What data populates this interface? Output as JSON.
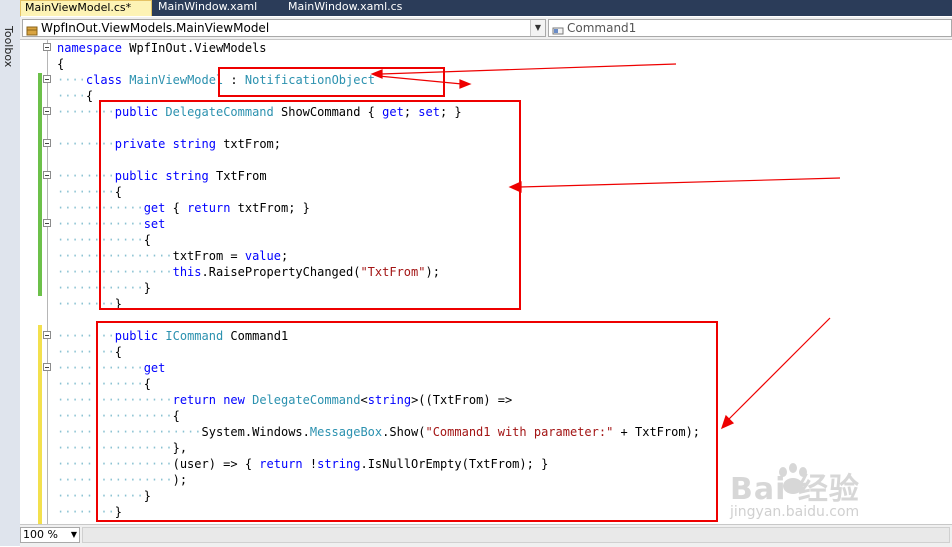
{
  "toolbox": {
    "label": "Toolbox"
  },
  "tabs": [
    {
      "label": "MainViewModel.cs*",
      "active": true
    },
    {
      "label": "MainWindow.xaml",
      "active": false
    },
    {
      "label": "MainWindow.xaml.cs",
      "active": false
    }
  ],
  "navbar": {
    "type_combo": "WpfInOut.ViewModels.MainViewModel",
    "member_combo": "Command1",
    "type_icon": "class-icon",
    "member_icon": "property-icon"
  },
  "code": {
    "l1": {
      "k": "namespace",
      "t": " WpfInOut.ViewModels"
    },
    "l2": {
      "t": "{"
    },
    "l3": {
      "k": "class",
      "a": " ",
      "b": "MainViewModel",
      "c": " : ",
      "d": "NotificationObject"
    },
    "l4": {
      "t": "{"
    },
    "l5": {
      "k": "public",
      "a": " ",
      "b": "DelegateCommand",
      "c": " ShowCommand { ",
      "d": "get",
      "e": "; ",
      "f": "set",
      "g": "; }"
    },
    "l6": {
      "k": "private",
      "a": " ",
      "b": "string",
      "c": " txtFrom;"
    },
    "l7": {
      "k": "public",
      "a": " ",
      "b": "string",
      "c": " TxtFrom"
    },
    "l8": {
      "t": "{"
    },
    "l9": {
      "k": "get",
      "a": " { ",
      "b": "return",
      "c": " txtFrom; }"
    },
    "l10": {
      "k": "set"
    },
    "l11": {
      "t": "{"
    },
    "l12": {
      "a": "txtFrom = ",
      "k": "value",
      "c": ";"
    },
    "l13": {
      "k": "this",
      "a": ".RaisePropertyChanged(",
      "s": "\"TxtFrom\"",
      "c": ");"
    },
    "l14": {
      "t": "}"
    },
    "l15": {
      "t": "}"
    },
    "l16": {
      "k": "public",
      "a": " ",
      "b": "ICommand",
      "c": " Command1"
    },
    "l17": {
      "t": "{"
    },
    "l18": {
      "k": "get"
    },
    "l19": {
      "t": "{"
    },
    "l20": {
      "k": "return",
      "a": " ",
      "k2": "new",
      "a2": " ",
      "b": "DelegateCommand",
      "c": "<",
      "k3": "string",
      "d": ">((TxtFrom) =>"
    },
    "l21": {
      "t": "{"
    },
    "l22": {
      "a": "System.Windows.",
      "b": "MessageBox",
      "c": ".Show(",
      "s": "\"Command1 with parameter:\"",
      "d": " + TxtFrom);"
    },
    "l23": {
      "t": "},"
    },
    "l24": {
      "a": "(user) => { ",
      "k": "return",
      "c": " !",
      "k2": "string",
      "d": ".IsNullOrEmpty(TxtFrom); }"
    },
    "l25": {
      "t": ");"
    },
    "l26": {
      "t": "}"
    },
    "l27": {
      "t": "}"
    }
  },
  "statusbar": {
    "zoom": "100 %"
  },
  "watermark": {
    "brand": "Bai  经验",
    "url": "jingyan.baidu.com"
  },
  "annotation_color": "#ee0000",
  "tab_active_color": "#fdf3b5",
  "tabbar_color": "#2b3c59"
}
